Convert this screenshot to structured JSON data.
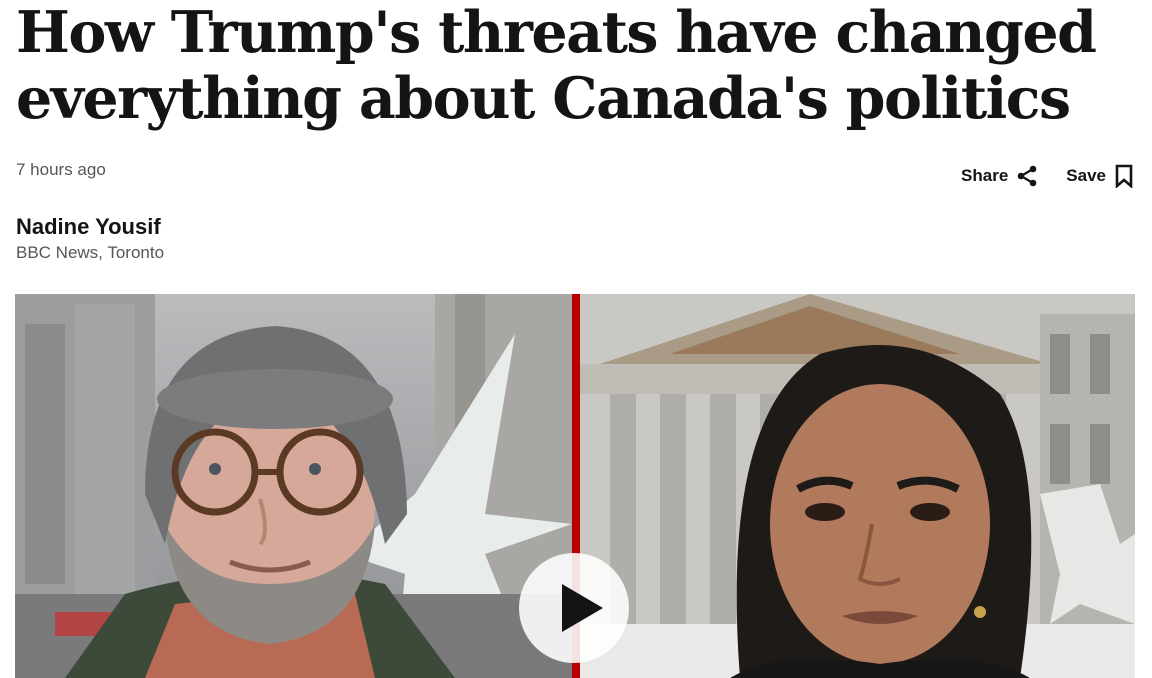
{
  "article": {
    "headline": "How Trump's threats have changed everything about Canada's politics",
    "timestamp": "7 hours ago",
    "author_name": "Nadine Yousif",
    "author_org": "BBC News, Toronto"
  },
  "actions": {
    "share_label": "Share",
    "save_label": "Save"
  },
  "icons": {
    "share": "share-icon",
    "save": "bookmark-icon",
    "play": "play-icon"
  },
  "colors": {
    "divider": "#b80000",
    "text": "#141414",
    "muted": "#545658"
  }
}
